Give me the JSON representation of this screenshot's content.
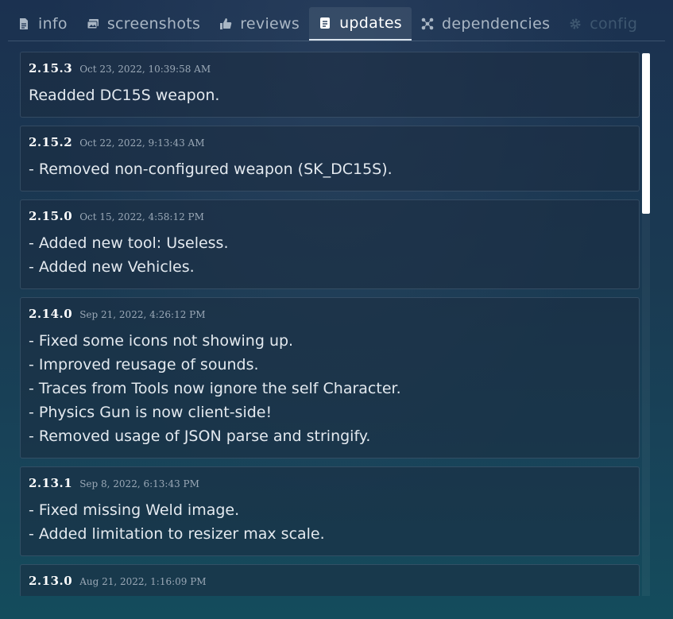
{
  "tabs": [
    {
      "label": "info",
      "icon": "document-icon"
    },
    {
      "label": "screenshots",
      "icon": "images-icon"
    },
    {
      "label": "reviews",
      "icon": "thumbs-up-icon"
    },
    {
      "label": "updates",
      "icon": "notes-icon"
    },
    {
      "label": "dependencies",
      "icon": "nodes-icon"
    },
    {
      "label": "config",
      "icon": "gear-icon"
    }
  ],
  "active_tab": "updates",
  "updates": [
    {
      "version": "2.15.3",
      "date": "Oct 23, 2022, 10:39:58 AM",
      "lines": [
        "Readded DC15S weapon."
      ]
    },
    {
      "version": "2.15.2",
      "date": "Oct 22, 2022, 9:13:43 AM",
      "lines": [
        "- Removed non-configured weapon (SK_DC15S)."
      ]
    },
    {
      "version": "2.15.0",
      "date": "Oct 15, 2022, 4:58:12 PM",
      "lines": [
        "- Added new tool: Useless.",
        "- Added new Vehicles."
      ]
    },
    {
      "version": "2.14.0",
      "date": "Sep 21, 2022, 4:26:12 PM",
      "lines": [
        "- Fixed some icons not showing up.",
        "- Improved reusage of sounds.",
        "- Traces from Tools now ignore the self Character.",
        "- Physics Gun is now client-side!",
        "- Removed usage of JSON parse and stringify."
      ]
    },
    {
      "version": "2.13.1",
      "date": "Sep 8, 2022, 6:13:43 PM",
      "lines": [
        "- Fixed missing Weld image.",
        "- Added limitation to resizer max scale."
      ]
    },
    {
      "version": "2.13.0",
      "date": "Aug 21, 2022, 1:16:09 PM",
      "lines": []
    }
  ]
}
